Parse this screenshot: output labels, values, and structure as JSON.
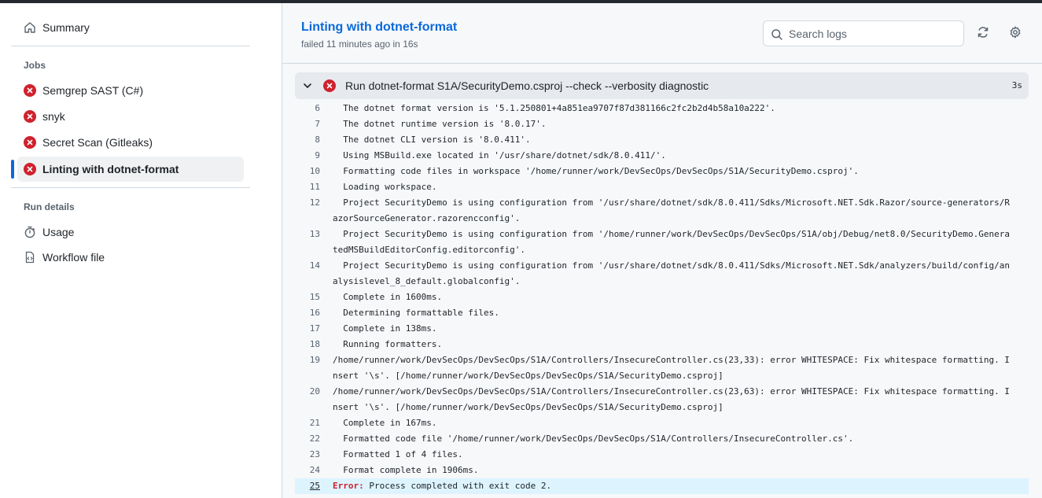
{
  "sidebar": {
    "summary_label": "Summary",
    "jobs_heading": "Jobs",
    "jobs": [
      {
        "label": "Semgrep SAST (C#)",
        "status": "failed"
      },
      {
        "label": "snyk",
        "status": "failed"
      },
      {
        "label": "Secret Scan (Gitleaks)",
        "status": "failed"
      },
      {
        "label": "Linting with dotnet-format",
        "status": "failed",
        "active": true
      }
    ],
    "run_details_heading": "Run details",
    "usage_label": "Usage",
    "workflow_file_label": "Workflow file"
  },
  "header": {
    "title": "Linting with dotnet-format",
    "status": "failed 11 minutes ago in 16s",
    "search_placeholder": "Search logs"
  },
  "step": {
    "title": "Run dotnet-format S1A/SecurityDemo.csproj --check --verbosity diagnostic",
    "duration": "3s"
  },
  "log_lines": [
    {
      "n": "6",
      "t": "  The dotnet format version is '5.1.250801+4a851ea9707f87d381166c2fc2b2d4b58a10a222'."
    },
    {
      "n": "7",
      "t": "  The dotnet runtime version is '8.0.17'."
    },
    {
      "n": "8",
      "t": "  The dotnet CLI version is '8.0.411'."
    },
    {
      "n": "9",
      "t": "  Using MSBuild.exe located in '/usr/share/dotnet/sdk/8.0.411/'."
    },
    {
      "n": "10",
      "t": "  Formatting code files in workspace '/home/runner/work/DevSecOps/DevSecOps/S1A/SecurityDemo.csproj'."
    },
    {
      "n": "11",
      "t": "  Loading workspace."
    },
    {
      "n": "12",
      "t": "  Project SecurityDemo is using configuration from '/usr/share/dotnet/sdk/8.0.411/Sdks/Microsoft.NET.Sdk.Razor/source-generators/RazorSourceGenerator.razorencconfig'."
    },
    {
      "n": "13",
      "t": "  Project SecurityDemo is using configuration from '/home/runner/work/DevSecOps/DevSecOps/S1A/obj/Debug/net8.0/SecurityDemo.GeneratedMSBuildEditorConfig.editorconfig'."
    },
    {
      "n": "14",
      "t": "  Project SecurityDemo is using configuration from '/usr/share/dotnet/sdk/8.0.411/Sdks/Microsoft.NET.Sdk/analyzers/build/config/analysislevel_8_default.globalconfig'."
    },
    {
      "n": "15",
      "t": "  Complete in 1600ms."
    },
    {
      "n": "16",
      "t": "  Determining formattable files."
    },
    {
      "n": "17",
      "t": "  Complete in 138ms."
    },
    {
      "n": "18",
      "t": "  Running formatters."
    },
    {
      "n": "19",
      "t": "/home/runner/work/DevSecOps/DevSecOps/S1A/Controllers/InsecureController.cs(23,33): error WHITESPACE: Fix whitespace formatting. Insert '\\s'. [/home/runner/work/DevSecOps/DevSecOps/S1A/SecurityDemo.csproj]"
    },
    {
      "n": "20",
      "t": "/home/runner/work/DevSecOps/DevSecOps/S1A/Controllers/InsecureController.cs(23,63): error WHITESPACE: Fix whitespace formatting. Insert '\\s'. [/home/runner/work/DevSecOps/DevSecOps/S1A/SecurityDemo.csproj]"
    },
    {
      "n": "21",
      "t": "  Complete in 167ms."
    },
    {
      "n": "22",
      "t": "  Formatted code file '/home/runner/work/DevSecOps/DevSecOps/S1A/Controllers/InsecureController.cs'."
    },
    {
      "n": "23",
      "t": "  Formatted 1 of 4 files."
    },
    {
      "n": "24",
      "t": "  Format complete in 1906ms."
    }
  ],
  "error_line": {
    "n": "25",
    "prefix": "Error:",
    "message": " Process completed with exit code 2."
  },
  "colors": {
    "accent": "#0969da",
    "failure": "#cf222e"
  }
}
